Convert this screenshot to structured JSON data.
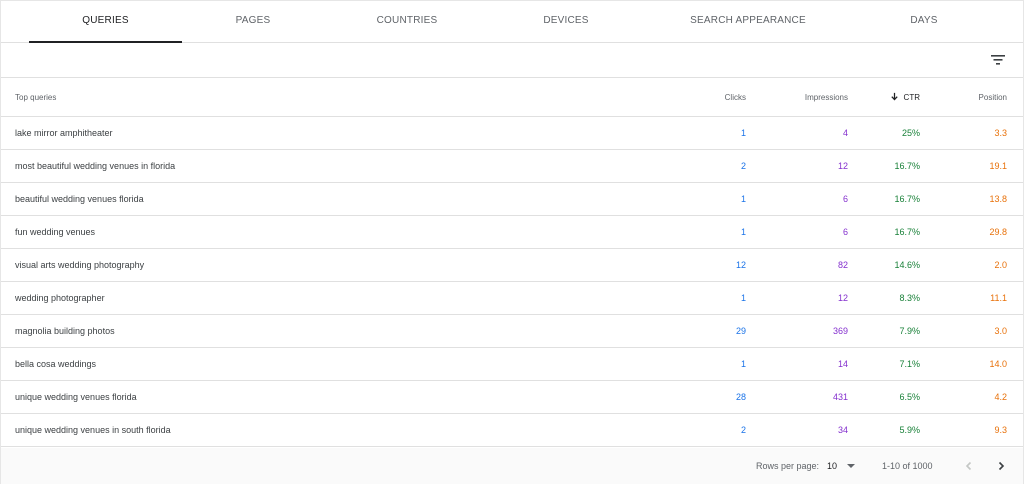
{
  "tabs": [
    {
      "label": "QUERIES",
      "active": true
    },
    {
      "label": "PAGES",
      "active": false
    },
    {
      "label": "COUNTRIES",
      "active": false
    },
    {
      "label": "DEVICES",
      "active": false
    },
    {
      "label": "SEARCH APPEARANCE",
      "active": false
    },
    {
      "label": "DAYS",
      "active": false
    }
  ],
  "toolbar": {
    "filter_icon": "filter-list-icon"
  },
  "table": {
    "headers": {
      "query": "Top queries",
      "clicks": "Clicks",
      "impressions": "Impressions",
      "ctr": "CTR",
      "position": "Position"
    },
    "sort": {
      "column": "ctr",
      "direction": "descending",
      "icon": "arrow-down-icon"
    },
    "rows": [
      {
        "query": "lake mirror amphitheater",
        "clicks": "1",
        "impressions": "4",
        "ctr": "25%",
        "position": "3.3"
      },
      {
        "query": "most beautiful wedding venues in florida",
        "clicks": "2",
        "impressions": "12",
        "ctr": "16.7%",
        "position": "19.1"
      },
      {
        "query": "beautiful wedding venues florida",
        "clicks": "1",
        "impressions": "6",
        "ctr": "16.7%",
        "position": "13.8"
      },
      {
        "query": "fun wedding venues",
        "clicks": "1",
        "impressions": "6",
        "ctr": "16.7%",
        "position": "29.8"
      },
      {
        "query": "visual arts wedding photography",
        "clicks": "12",
        "impressions": "82",
        "ctr": "14.6%",
        "position": "2.0"
      },
      {
        "query": "wedding photographer",
        "clicks": "1",
        "impressions": "12",
        "ctr": "8.3%",
        "position": "11.1"
      },
      {
        "query": "magnolia building photos",
        "clicks": "29",
        "impressions": "369",
        "ctr": "7.9%",
        "position": "3.0"
      },
      {
        "query": "bella cosa weddings",
        "clicks": "1",
        "impressions": "14",
        "ctr": "7.1%",
        "position": "14.0"
      },
      {
        "query": "unique wedding venues florida",
        "clicks": "28",
        "impressions": "431",
        "ctr": "6.5%",
        "position": "4.2"
      },
      {
        "query": "unique wedding venues in south florida",
        "clicks": "2",
        "impressions": "34",
        "ctr": "5.9%",
        "position": "9.3"
      }
    ]
  },
  "footer": {
    "rows_per_page_label": "Rows per page:",
    "rows_per_page_value": "10",
    "range_text": "1-10 of 1000",
    "prev_icon": "chevron-left-icon",
    "next_icon": "chevron-right-icon"
  },
  "colors": {
    "clicks": "#1a73e8",
    "impressions": "#8430ce",
    "ctr": "#188038",
    "position": "#e8710a"
  }
}
